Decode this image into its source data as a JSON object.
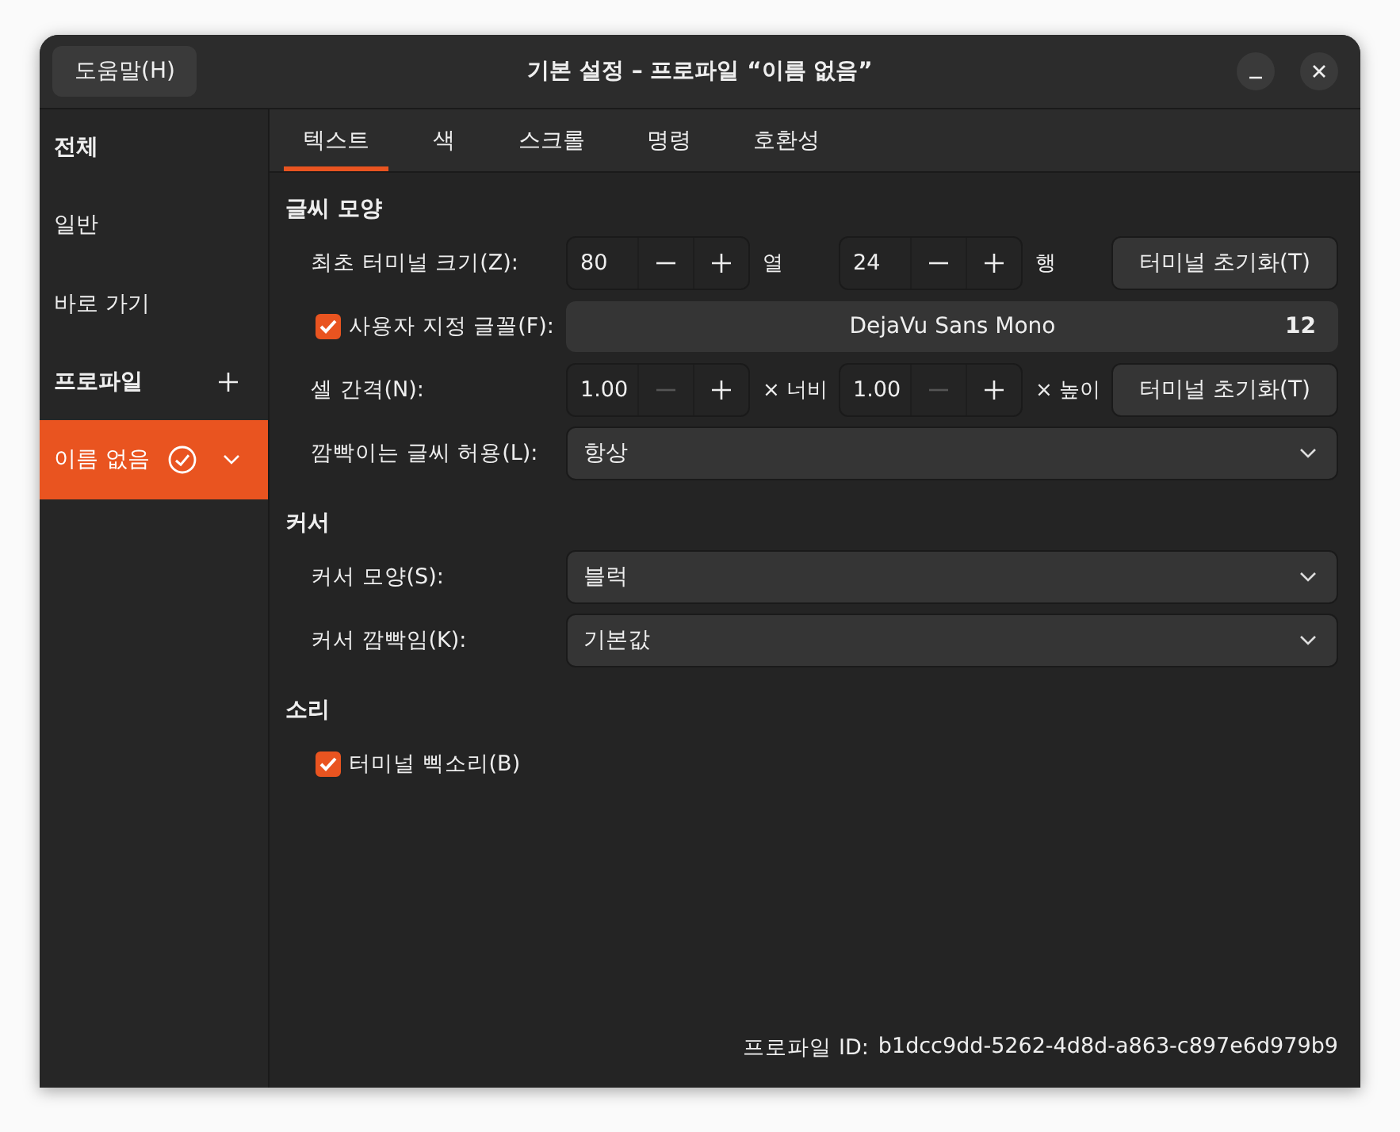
{
  "header": {
    "help_button": "도움말(H)",
    "title": "기본 설정 – 프로파일 “이름 없음”"
  },
  "sidebar": {
    "items": [
      {
        "kind": "heading",
        "label": "전체"
      },
      {
        "kind": "item",
        "label": "일반",
        "selected": false
      },
      {
        "kind": "item",
        "label": "바로 가기",
        "selected": false
      },
      {
        "kind": "heading-add",
        "label": "프로파일"
      },
      {
        "kind": "profile",
        "label": "이름 없음",
        "selected": true
      }
    ]
  },
  "tabs": [
    {
      "label": "텍스트",
      "selected": true
    },
    {
      "label": "색",
      "selected": false
    },
    {
      "label": "스크롤",
      "selected": false
    },
    {
      "label": "명령",
      "selected": false
    },
    {
      "label": "호환성",
      "selected": false
    }
  ],
  "sections": [
    {
      "title": "글씨 모양",
      "rows": [
        {
          "kind": "spins",
          "label": "최초 터미널 크기(Z):",
          "spins": [
            {
              "value": "80",
              "minus_disabled": false,
              "unit": "열"
            },
            {
              "value": "24",
              "minus_disabled": false,
              "unit": "행"
            }
          ],
          "button": "터미널 초기화(T)"
        },
        {
          "kind": "font",
          "label": "사용자 지정 글꼴(F):",
          "checked": true,
          "font": "DejaVu Sans Mono",
          "size": "12"
        },
        {
          "kind": "spins",
          "label": "셀 간격(N):",
          "spins": [
            {
              "value": "1.00",
              "minus_disabled": true,
              "unit": "× 너비"
            },
            {
              "value": "1.00",
              "minus_disabled": true,
              "unit": "× 높이"
            }
          ],
          "button": "터미널 초기화(T)"
        },
        {
          "kind": "dropdown",
          "label": "깜빡이는 글씨 허용(L):",
          "value": "항상"
        }
      ]
    },
    {
      "title": "커서",
      "rows": [
        {
          "kind": "dropdown",
          "label": "커서 모양(S):",
          "value": "블럭"
        },
        {
          "kind": "dropdown",
          "label": "커서 깜빡임(K):",
          "value": "기본값"
        }
      ]
    },
    {
      "title": "소리",
      "rows": [
        {
          "kind": "checkbox",
          "label": "터미널 삑소리(B)",
          "checked": true
        }
      ]
    }
  ],
  "footer": {
    "id_label": "프로파일 ID:",
    "id_value": "b1dcc9dd-5262-4d8d-a863-c897e6d979b9"
  }
}
